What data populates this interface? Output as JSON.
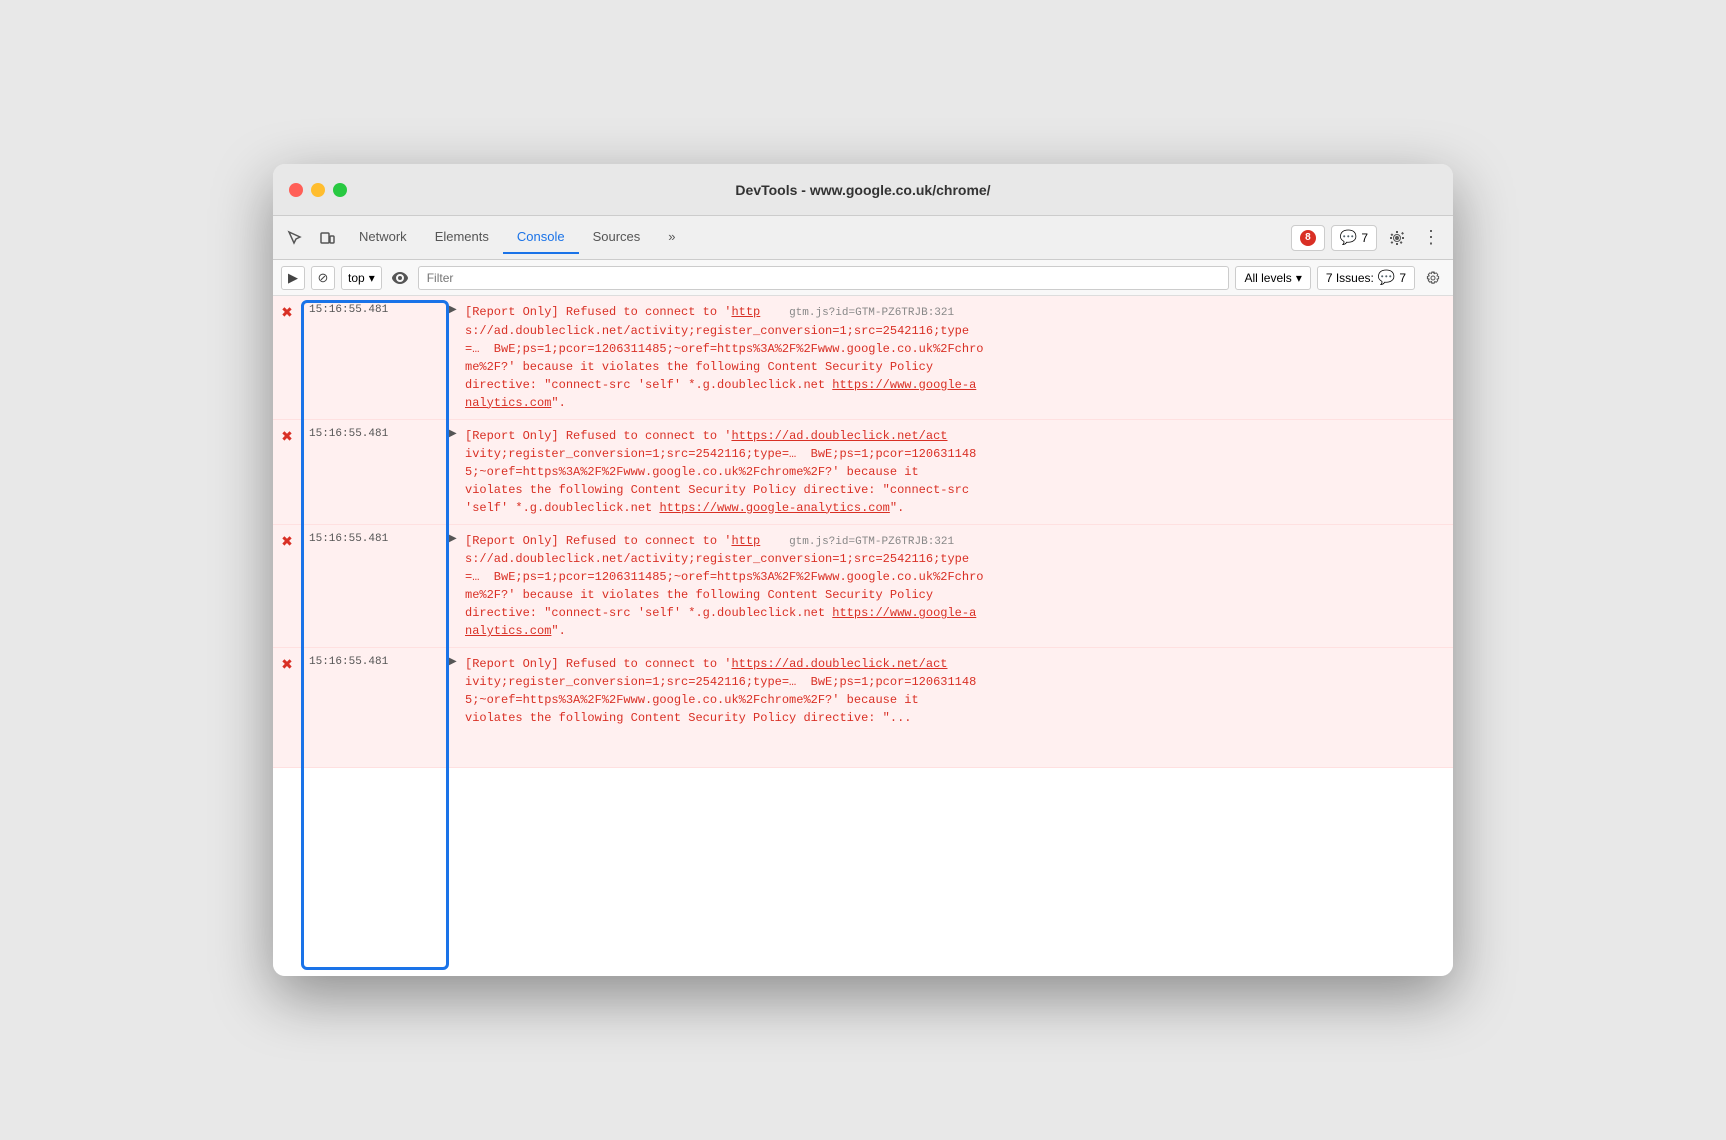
{
  "window": {
    "title": "DevTools - www.google.co.uk/chrome/"
  },
  "toolbar": {
    "tabs": [
      {
        "id": "network",
        "label": "Network",
        "active": false
      },
      {
        "id": "elements",
        "label": "Elements",
        "active": false
      },
      {
        "id": "console",
        "label": "Console",
        "active": true
      },
      {
        "id": "sources",
        "label": "Sources",
        "active": false
      },
      {
        "id": "more",
        "label": "»",
        "active": false
      }
    ],
    "error_badge": "8",
    "info_badge": "7",
    "gear_label": "⚙",
    "more_label": "⋮"
  },
  "console_toolbar": {
    "play_label": "▶",
    "stop_label": "⊘",
    "top_label": "top",
    "eye_label": "👁",
    "filter_placeholder": "Filter",
    "levels_label": "All levels",
    "issues_label": "7 Issues:",
    "issues_count": "7",
    "gear_label": "⚙"
  },
  "messages": [
    {
      "timestamp": "15:16:55.481",
      "source_ref": "gtm.js?id=GTM-PZ6TRJB:321",
      "text": "[Report Only] Refused to connect to 'http    gtm.js?id=GTM-PZ6TRJB:321\ns://ad.doubleclick.net/activity;register_conversion=1;src=2542116;type\n=…  BwE;ps=1;pcor=1206311485;~oref=https%3A%2F%2Fwww.google.co.uk%2Fchro\nme%2F?' because it violates the following Content Security Policy\ndirective: \"connect-src 'self' *.g.doubleclick.net https://www.google-a\nnalytics.com\"."
    },
    {
      "timestamp": "15:16:55.481",
      "source_ref": "",
      "text": "[Report Only] Refused to connect to 'https://ad.doubleclick.net/act\nivity;register_conversion=1;src=2542116;type=…  BwE;ps=1;pcor=120631148\n5;~oref=https%3A%2F%2Fwww.google.co.uk%2Fchrome%2F?' because it\nviolates the following Content Security Policy directive: \"connect-src\n'self' *.g.doubleclick.net https://www.google-analytics.com\"."
    },
    {
      "timestamp": "15:16:55.481",
      "source_ref": "gtm.js?id=GTM-PZ6TRJB:321",
      "text": "[Report Only] Refused to connect to 'http    gtm.js?id=GTM-PZ6TRJB:321\ns://ad.doubleclick.net/activity;register_conversion=1;src=2542116;type\n=…  BwE;ps=1;pcor=1206311485;~oref=https%3A%2F%2Fwww.google.co.uk%2Fchro\nme%2F?' because it violates the following Content Security Policy\ndirective: \"connect-src 'self' *.g.doubleclick.net https://www.google-a\nnalytics.com\"."
    },
    {
      "timestamp": "15:16:55.481",
      "source_ref": "",
      "text": "[Report Only] Refused to connect to 'https://ad.doubleclick.net/act\nivity;register_conversion=1;src=2542116;type=…  BwE;ps=1;pcor=120631148\n5;~oref=https%3A%2F%2Fwww.google.co.uk%2Fchrome%2F?' because it\nviolates the following Content Security Policy directive: \"connect-src\n'self' *.g.doubleclick.net https://www.google-analytics.com\"."
    }
  ],
  "colors": {
    "error_red": "#d93025",
    "highlight_blue": "#1a73e8",
    "error_bg": "#fff0f0",
    "error_border": "#ffe0e0"
  }
}
